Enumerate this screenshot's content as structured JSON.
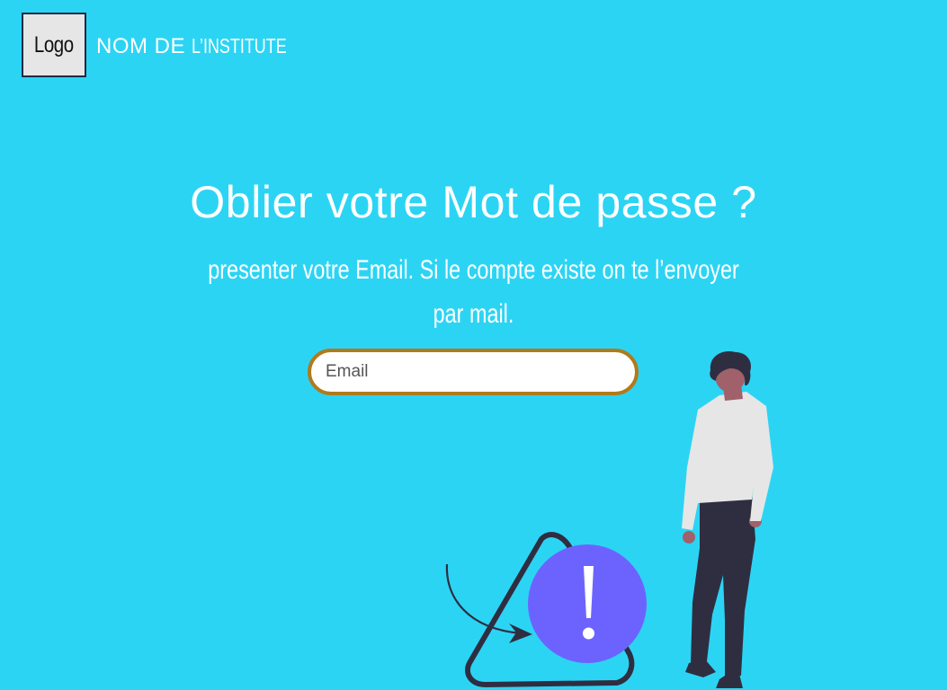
{
  "header": {
    "logo_label": "Logo",
    "institute_name_strong": "NOM DE",
    "institute_name_light": "L’INSTITUTE"
  },
  "main": {
    "title": "Oblier votre Mot de passe ?",
    "subtitle_line1": "presenter votre Email. Si le compte existe on te l’envoyer",
    "subtitle_line2": "par mail.",
    "email_placeholder": "Email",
    "email_value": ""
  },
  "illustration": {
    "name": "person-with-warning-illustration",
    "alert_symbol": "!"
  },
  "colors": {
    "background": "#2cd4f4",
    "text": "#ffffff",
    "input_border": "#b07a1c",
    "alert_circle": "#6c63ff",
    "figure_dark": "#2f2e41",
    "figure_shirt": "#e6e6e6",
    "skin": "#a0616a"
  }
}
